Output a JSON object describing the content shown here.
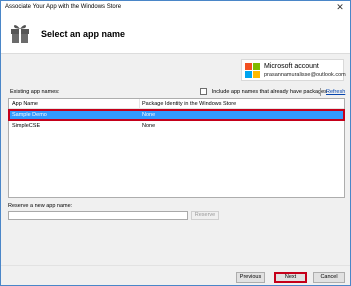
{
  "window": {
    "title": "Associate Your App with the Windows Store",
    "close_glyph": "✕"
  },
  "header": {
    "heading": "Select an app name",
    "icon": "gift-box-icon"
  },
  "account": {
    "title": "Microsoft account",
    "email": "prasannamuralisse@outlook.com",
    "logo_colors": [
      "#f25022",
      "#7fba00",
      "#00a4ef",
      "#ffb900"
    ]
  },
  "existing": {
    "label": "Existing app names:",
    "include_checkbox_label": "Include app names that already have packages",
    "include_checked": false,
    "refresh_label": "Refresh"
  },
  "grid": {
    "columns": [
      "App Name",
      "Package Identity in the Windows Store"
    ],
    "rows": [
      {
        "name": "Sample Demo",
        "identity": "None",
        "selected": true
      },
      {
        "name": "SimpleCSE",
        "identity": "None",
        "selected": false
      }
    ]
  },
  "reserve": {
    "label": "Reserve a new app name:",
    "value": "",
    "button_label": "Reserve"
  },
  "footer": {
    "previous_label": "Previous",
    "next_label": "Next",
    "cancel_label": "Cancel"
  },
  "colors": {
    "selection": "#3399ff",
    "highlight_border": "#c5001a",
    "window_border": "#4a86c8"
  }
}
